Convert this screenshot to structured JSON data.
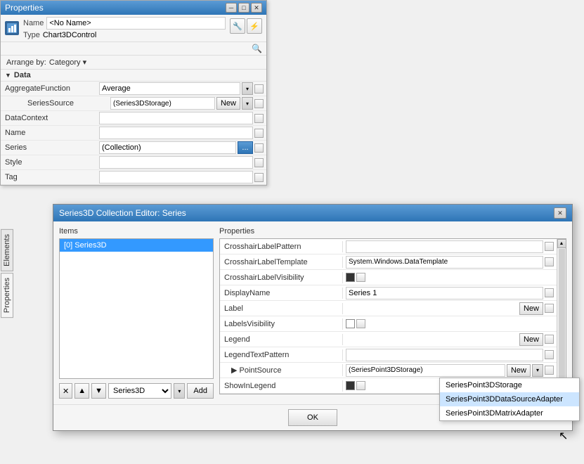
{
  "properties_panel": {
    "title": "Properties",
    "name_label": "Name",
    "name_value": "<No Name>",
    "type_label": "Type",
    "type_value": "Chart3DControl",
    "arrange_label": "Arrange by:",
    "arrange_value": "Category",
    "sections": {
      "data": {
        "label": "Data",
        "properties": [
          {
            "name": "AggregateFunction",
            "value": "Average",
            "type": "dropdown"
          },
          {
            "name": "SeriesSource",
            "value": "(Series3DStorage)",
            "type": "button_new",
            "sub": true
          },
          {
            "name": "DataContext",
            "value": "",
            "type": "input"
          },
          {
            "name": "Name",
            "value": "",
            "type": "input"
          },
          {
            "name": "Series",
            "value": "(Collection)",
            "type": "ellipsis"
          },
          {
            "name": "Style",
            "value": "",
            "type": "input"
          },
          {
            "name": "Tag",
            "value": "",
            "type": "input"
          }
        ]
      }
    },
    "sidebar_tabs": [
      "Elements",
      "Properties"
    ]
  },
  "collection_editor": {
    "title": "Series3D Collection Editor: Series",
    "items_label": "Items",
    "items": [
      {
        "index": 0,
        "label": "[0] Series3D",
        "selected": true
      }
    ],
    "toolbar": {
      "remove_btn": "✕",
      "up_btn": "▲",
      "down_btn": "▼",
      "type_value": "Series3D",
      "add_btn": "Add"
    },
    "properties_label": "Properties",
    "properties": [
      {
        "name": "CrosshairLabelPattern",
        "value": "",
        "type": "input"
      },
      {
        "name": "CrosshairLabelTemplate",
        "value": "System.Windows.DataTemplate",
        "type": "input"
      },
      {
        "name": "CrosshairLabelVisibility",
        "value": "checked",
        "type": "checkbox"
      },
      {
        "name": "DisplayName",
        "value": "Series 1",
        "type": "input"
      },
      {
        "name": "Label",
        "value": "",
        "type": "btn_new"
      },
      {
        "name": "LabelsVisibility",
        "value": "",
        "type": "checkbox_empty"
      },
      {
        "name": "Legend",
        "value": "",
        "type": "btn_new"
      },
      {
        "name": "LegendTextPattern",
        "value": "",
        "type": "input"
      },
      {
        "name": "PointSource",
        "value": "(SeriesPoint3DStorage)",
        "type": "btn_new_dropdown",
        "sub": true
      },
      {
        "name": "ShowInLegend",
        "value": "checked",
        "type": "checkbox"
      }
    ],
    "ok_btn": "OK",
    "dropdown_items": [
      {
        "label": "SeriesPoint3DStorage",
        "selected": false
      },
      {
        "label": "SeriesPoint3DDataSourceAdapter",
        "selected": false
      },
      {
        "label": "SeriesPoint3DMatrixAdapter",
        "selected": false
      }
    ]
  }
}
